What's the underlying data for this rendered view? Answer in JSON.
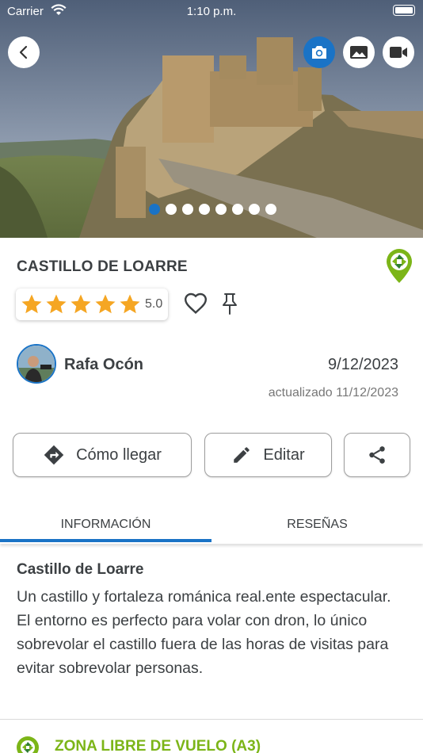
{
  "status_bar": {
    "carrier": "Carrier",
    "time": "1:10 p.m."
  },
  "hero": {
    "media_buttons": [
      "camera-icon",
      "gallery-icon",
      "video-icon"
    ],
    "carousel": {
      "count": 8,
      "active_index": 0
    }
  },
  "spot": {
    "title": "CASTILLO DE LOARRE",
    "rating": "5.0",
    "stars": 5,
    "author": "Rafa Ocón",
    "date": "9/12/2023",
    "updated": "actualizado 11/12/2023"
  },
  "actions": {
    "route_label": "Cómo llegar",
    "edit_label": "Editar"
  },
  "tabs": {
    "info": "INFORMACIÓN",
    "reviews": "RESEÑAS",
    "active": "info"
  },
  "description": {
    "title": "Castillo de Loarre",
    "text": "Un castillo y fortaleza románica real.ente espectacular. El entorno es perfecto para volar con dron, lo único sobrevolar el castillo fuera de las horas de visitas para evitar sobrevolar personas."
  },
  "zone": {
    "label": "ZONA LIBRE DE VUELO (A3)"
  },
  "colors": {
    "accent": "#1a73c6",
    "zone_green": "#7cb518",
    "star": "#f5a623"
  }
}
